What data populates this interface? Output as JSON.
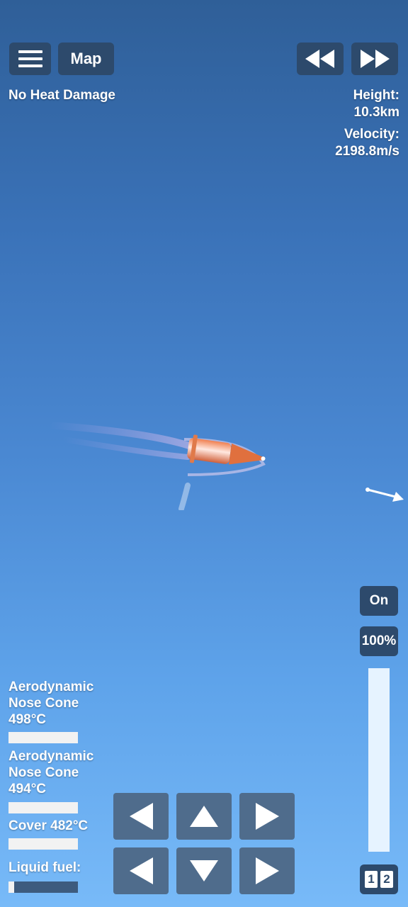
{
  "top_bar": {
    "map_label": "Map",
    "status": "No Heat Damage"
  },
  "readouts": {
    "height_label": "Height:",
    "height_value": "10.3km",
    "velocity_label": "Velocity:",
    "velocity_value": "2198.8m/s"
  },
  "engine": {
    "toggle_label": "On",
    "throttle_label": "100%",
    "throttle_fraction": 1.0
  },
  "parts": [
    {
      "name_line1": "Aerodynamic",
      "name_line2": "Nose Cone",
      "temp": "498°C"
    },
    {
      "name_line1": "Aerodynamic",
      "name_line2": "Nose Cone",
      "temp": "494°C"
    },
    {
      "label": "Cover 482°C"
    },
    {
      "label": "Liquid fuel:",
      "fuel_fraction": 0.08
    }
  ],
  "stages": {
    "first": "1",
    "second": "2"
  },
  "icons": [
    "menu-icon",
    "rewind-icon",
    "fast-forward-icon",
    "rotate-left-icon",
    "thrust-up-icon",
    "rotate-right-icon",
    "translate-left-icon",
    "thrust-down-icon",
    "translate-right-icon",
    "prograde-arrow-icon"
  ]
}
